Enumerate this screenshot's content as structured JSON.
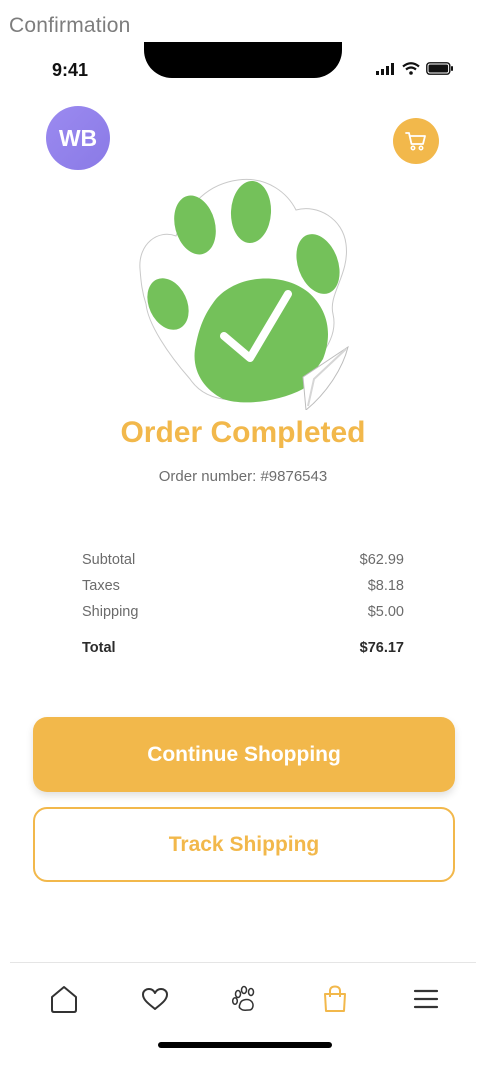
{
  "frame_label": "Confirmation",
  "status_bar": {
    "time": "9:41"
  },
  "header": {
    "avatar_initials": "WB",
    "cart_icon": "cart-icon"
  },
  "hero": {
    "icon": "paw-check-icon",
    "title": "Order Completed",
    "order_number": "Order number: #9876543"
  },
  "summary": {
    "subtotal_label": "Subtotal",
    "subtotal_value": "$62.99",
    "taxes_label": "Taxes",
    "taxes_value": "$8.18",
    "shipping_label": "Shipping",
    "shipping_value": "$5.00",
    "total_label": "Total",
    "total_value": "$76.17"
  },
  "actions": {
    "continue_label": "Continue Shopping",
    "track_label": "Track Shipping"
  },
  "tabbar": {
    "items": [
      "home-icon",
      "heart-icon",
      "paw-icon",
      "shopping-bag-icon",
      "menu-icon"
    ],
    "active": "shopping-bag-icon"
  },
  "colors": {
    "accent": "#f2b84b",
    "success": "#74c15a",
    "avatar": "#9b8af0",
    "text_muted": "#6b6b6b"
  }
}
